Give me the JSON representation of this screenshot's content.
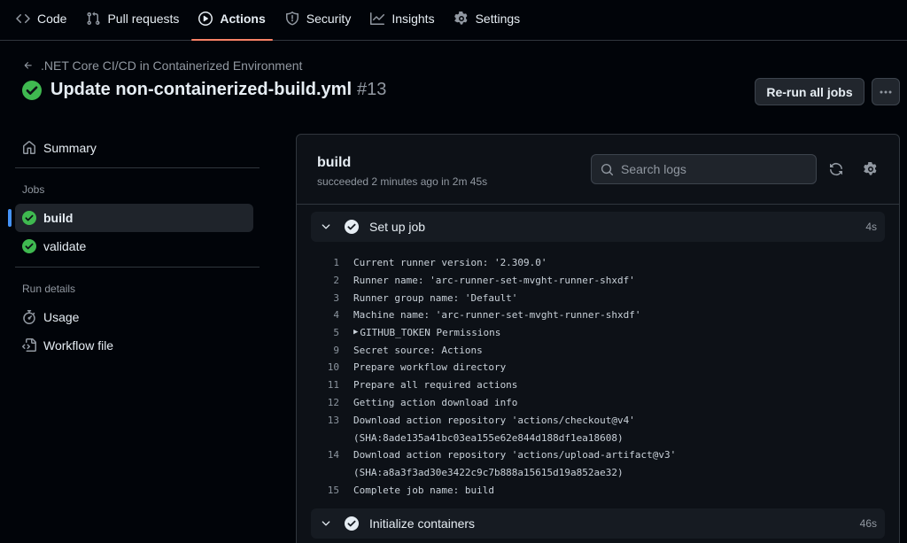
{
  "nav": {
    "tabs": [
      {
        "label": "Code",
        "icon": "code-icon"
      },
      {
        "label": "Pull requests",
        "icon": "git-pull-request-icon"
      },
      {
        "label": "Actions",
        "icon": "play-icon",
        "active": true
      },
      {
        "label": "Security",
        "icon": "shield-icon"
      },
      {
        "label": "Insights",
        "icon": "graph-icon"
      },
      {
        "label": "Settings",
        "icon": "gear-icon"
      }
    ]
  },
  "header": {
    "back_label": ".NET Core CI/CD in Containerized Environment",
    "title": "Update non-containerized-build.yml",
    "run_number": "#13",
    "rerun_label": "Re-run all jobs",
    "more_label": "···"
  },
  "sidebar": {
    "summary_label": "Summary",
    "jobs_heading": "Jobs",
    "jobs": [
      {
        "label": "build",
        "active": true
      },
      {
        "label": "validate",
        "active": false
      }
    ],
    "run_details_heading": "Run details",
    "details": [
      {
        "label": "Usage",
        "icon": "stopwatch-icon"
      },
      {
        "label": "Workflow file",
        "icon": "file-code-icon"
      }
    ]
  },
  "job": {
    "name": "build",
    "status": "succeeded 2 minutes ago in 2m 45s",
    "search_placeholder": "Search logs",
    "steps": [
      {
        "name": "Set up job",
        "duration": "4s"
      },
      {
        "name": "Initialize containers",
        "duration": "46s"
      }
    ],
    "log": [
      {
        "n": "1",
        "text": "Current runner version: '2.309.0'"
      },
      {
        "n": "2",
        "text": "Runner name: 'arc-runner-set-mvght-runner-shxdf'"
      },
      {
        "n": "3",
        "text": "Runner group name: 'Default'"
      },
      {
        "n": "4",
        "text": "Machine name: 'arc-runner-set-mvght-runner-shxdf'"
      },
      {
        "n": "5",
        "text": "GITHUB_TOKEN Permissions",
        "collapsible": true,
        "caret": "▶"
      },
      {
        "n": "9",
        "text": "Secret source: Actions"
      },
      {
        "n": "10",
        "text": "Prepare workflow directory"
      },
      {
        "n": "11",
        "text": "Prepare all required actions"
      },
      {
        "n": "12",
        "text": "Getting action download info"
      },
      {
        "n": "13",
        "text": "Download action repository 'actions/checkout@v4'"
      },
      {
        "n": "",
        "text": "(SHA:8ade135a41bc03ea155e62e844d188df1ea18608)"
      },
      {
        "n": "14",
        "text": "Download action repository 'actions/upload-artifact@v3'"
      },
      {
        "n": "",
        "text": "(SHA:a8a3f3ad30e3422c9c7b888a15615d19a852ae32)"
      },
      {
        "n": "15",
        "text": "Complete job name: build"
      }
    ]
  },
  "colors": {
    "background": "#010409",
    "panel": "#0d1117",
    "success": "#3fb950",
    "accent_underline": "#f78166",
    "active_indicator": "#4493f8",
    "muted_text": "#9198a1"
  }
}
